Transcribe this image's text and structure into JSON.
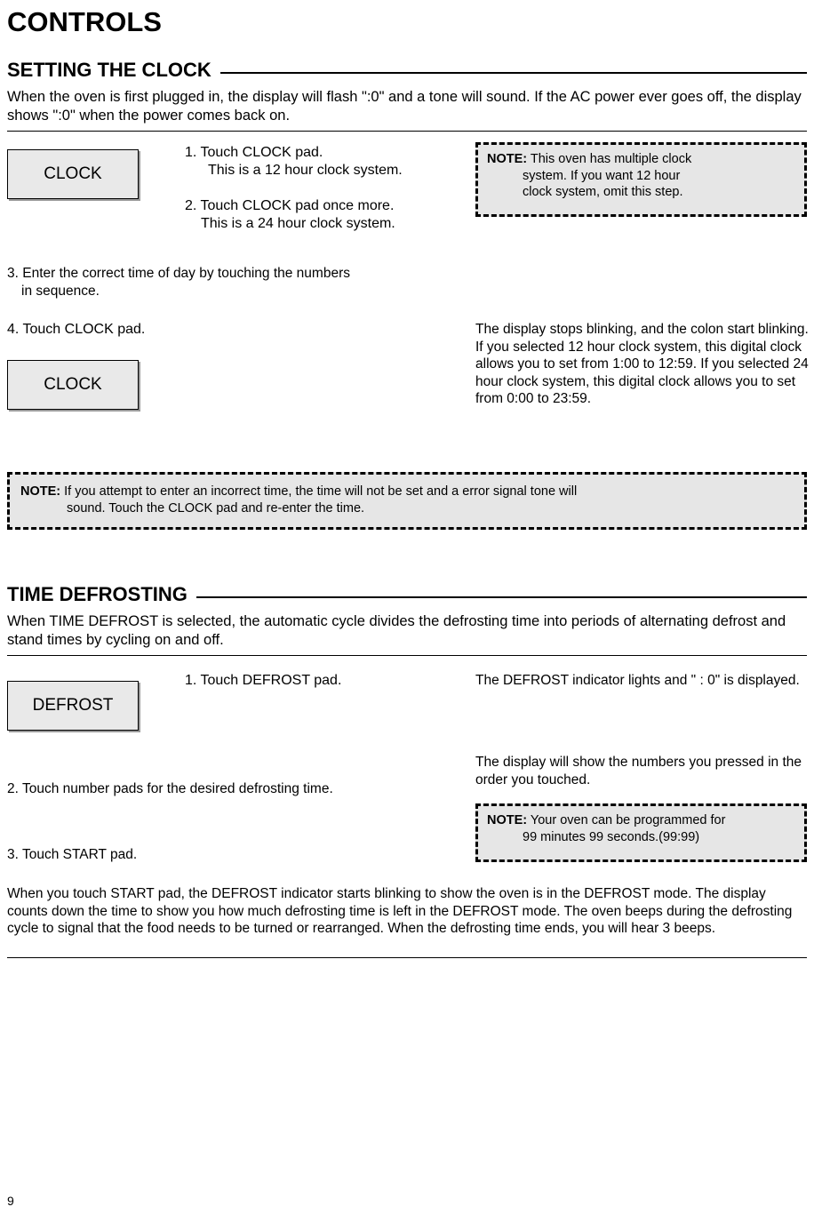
{
  "page": {
    "title": "CONTROLS",
    "number": "9"
  },
  "clock_section": {
    "heading": "SETTING THE CLOCK",
    "intro": "When the oven is first plugged in, the display will flash \":0\" and a tone will sound. If the AC power ever goes off, the display shows \":0\" when the power  comes back on.",
    "pad1_label": "CLOCK",
    "step1_line1": "1. Touch CLOCK pad.",
    "step1_line2": "This is a 12 hour clock system.",
    "step2_line1": "2. Touch CLOCK pad once more.",
    "step2_line2": "This is a 24 hour clock system.",
    "note1_label": "NOTE:",
    "note1_line1": "This oven has multiple clock",
    "note1_line2": "system. If you want 12 hour",
    "note1_line3": "clock system, omit this step.",
    "step3_line1": "3. Enter the correct time of day by touching the numbers",
    "step3_line2": "in sequence.",
    "step4": "4. Touch CLOCK pad.",
    "pad2_label": "CLOCK",
    "result_text": "The display stops blinking, and the colon start blinking. If you selected 12 hour clock system, this digital clock allows you to set from 1:00 to 12:59. If you selected 24 hour clock system, this digital clock allows you to set from 0:00 to 23:59.",
    "note2_label": "NOTE:",
    "note2_line1": "If you attempt to enter an incorrect time, the time will not be set and a error signal tone will",
    "note2_line2": "sound. Touch the CLOCK pad and re-enter the time."
  },
  "defrost_section": {
    "heading": "TIME DEFROSTING",
    "intro": "When TIME DEFROST is selected, the automatic cycle divides the defrosting time into periods of alternating defrost and stand times by cycling on and off.",
    "pad_label": "DEFROST",
    "step1": "1. Touch DEFROST pad.",
    "step1_result": "The DEFROST indicator lights and \" : 0\" is displayed.",
    "step2": "2. Touch number pads for the desired defrosting time.",
    "step2_result": "The display will show the numbers you pressed in the order you touched.",
    "note_label": "NOTE:",
    "note_line1": "Your oven can be programmed for",
    "note_line2": "99 minutes 99 seconds.(99:99)",
    "step3": "3. Touch START pad.",
    "closing": "When you touch START pad, the DEFROST indicator starts blinking to show the oven is in the DEFROST mode. The display counts down the time to show you how much defrosting time is left in the DEFROST mode. The oven beeps during the defrosting cycle to signal that the food needs to be turned or rearranged. When the defrosting time ends, you will hear 3 beeps."
  }
}
